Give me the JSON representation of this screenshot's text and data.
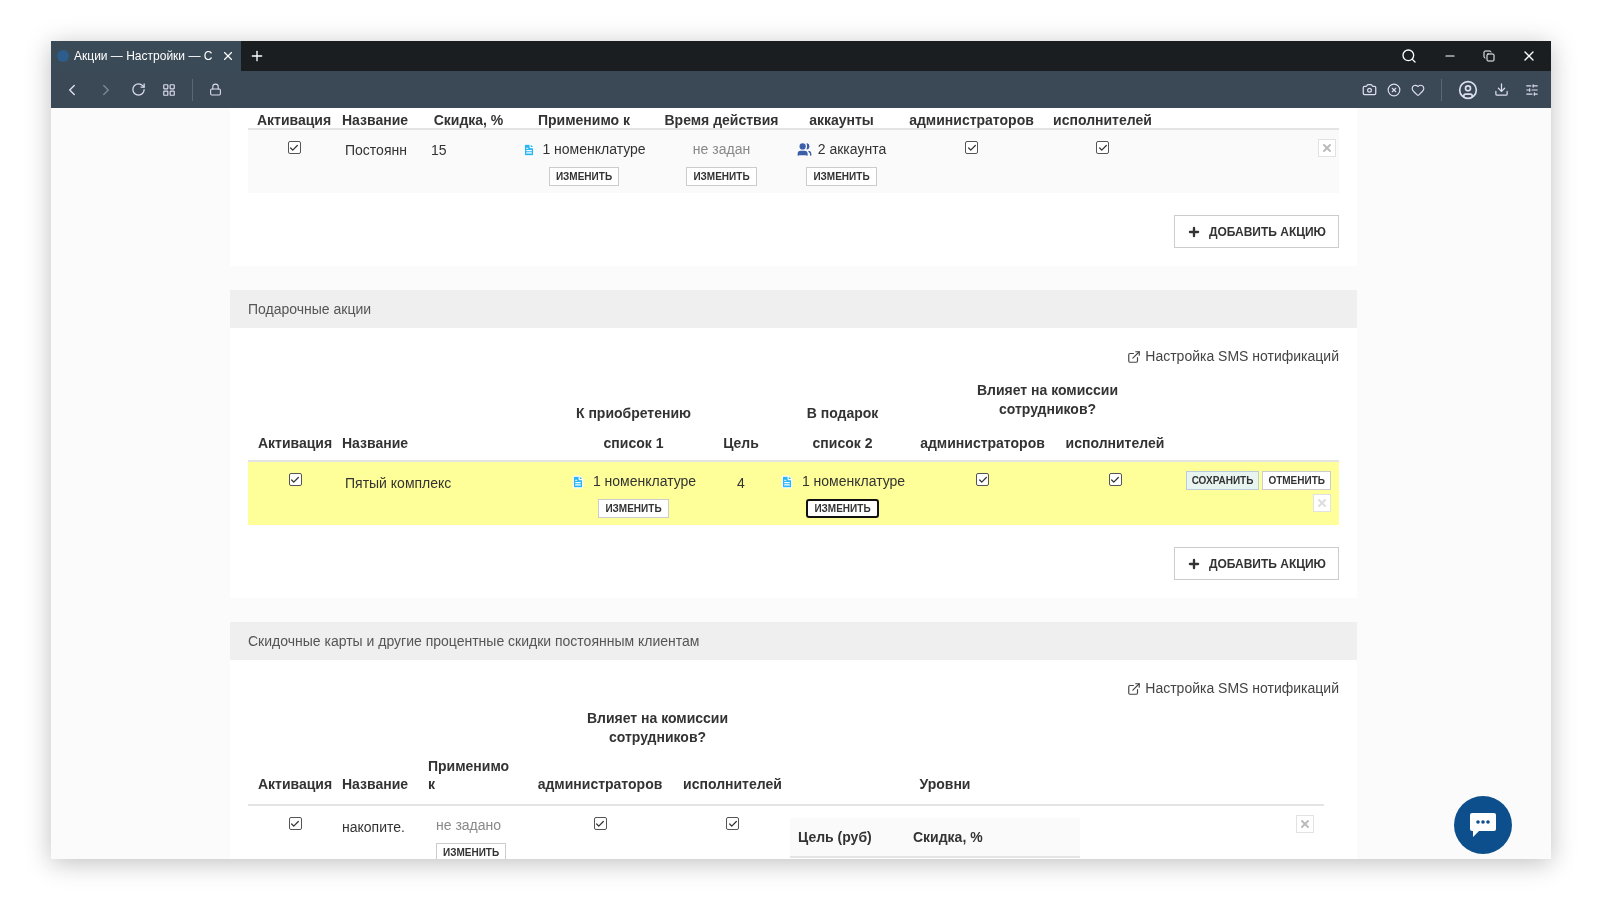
{
  "window": {
    "tab_title": "Акции — Настройки — С"
  },
  "discounts": {
    "columns": [
      "Активация",
      "Название",
      "Скидка, %",
      "Применимо к",
      "Время действия",
      "аккаунты",
      "администраторов",
      "исполнителей"
    ],
    "rows": [
      {
        "active": true,
        "name": "Постоянн",
        "discount": "15",
        "applies": "1 номенклатуре",
        "applies_button": "ИЗМЕНИТЬ",
        "period": "не задан",
        "period_button": "ИЗМЕНИТЬ",
        "accounts": "2 аккаунта",
        "accounts_button": "ИЗМЕНИТЬ",
        "admins": true,
        "performers": true
      }
    ],
    "add_button": "ДОБАВИТЬ АКЦИЮ"
  },
  "gifts": {
    "title": "Подарочные акции",
    "sms_link": "Настройка SMS нотификаций",
    "group_header": "Влияет на комиссии сотрудников?",
    "purchase_header": "К приобретению",
    "gift_header": "В подарок",
    "columns": [
      "Активация",
      "Название",
      "список 1",
      "Цель",
      "список 2",
      "администраторов",
      "исполнителей"
    ],
    "rows": [
      {
        "active": true,
        "editing": true,
        "name": "Пятый комплекс",
        "list1": "1 номенклатуре",
        "list1_button": "ИЗМЕНИТЬ",
        "list1_button_focused": false,
        "goal": "4",
        "list2": "1 номенклатуре",
        "list2_button": "ИЗМЕНИТЬ",
        "list2_button_focused": true,
        "admins": true,
        "performers": true,
        "save_button": "СОХРАНИТЬ",
        "cancel_button": "ОТМЕНИТЬ"
      }
    ],
    "add_button": "ДОБАВИТЬ АКЦИЮ"
  },
  "cards": {
    "title": "Скидочные карты и другие процентные скидки постоянным клиентам",
    "sms_link": "Настройка SMS нотификаций",
    "group_header": "Влияет на комиссии сотрудников?",
    "columns": [
      "Активация",
      "Название",
      "Применимо к",
      "администраторов",
      "исполнителей",
      "Уровни"
    ],
    "rows": [
      {
        "active": true,
        "name": "накопите.",
        "applies": "не задано",
        "applies_button": "ИЗМЕНИТЬ",
        "admins": true,
        "performers": true,
        "level_columns": [
          "Цель (руб)",
          "Скидка, %"
        ]
      }
    ]
  }
}
